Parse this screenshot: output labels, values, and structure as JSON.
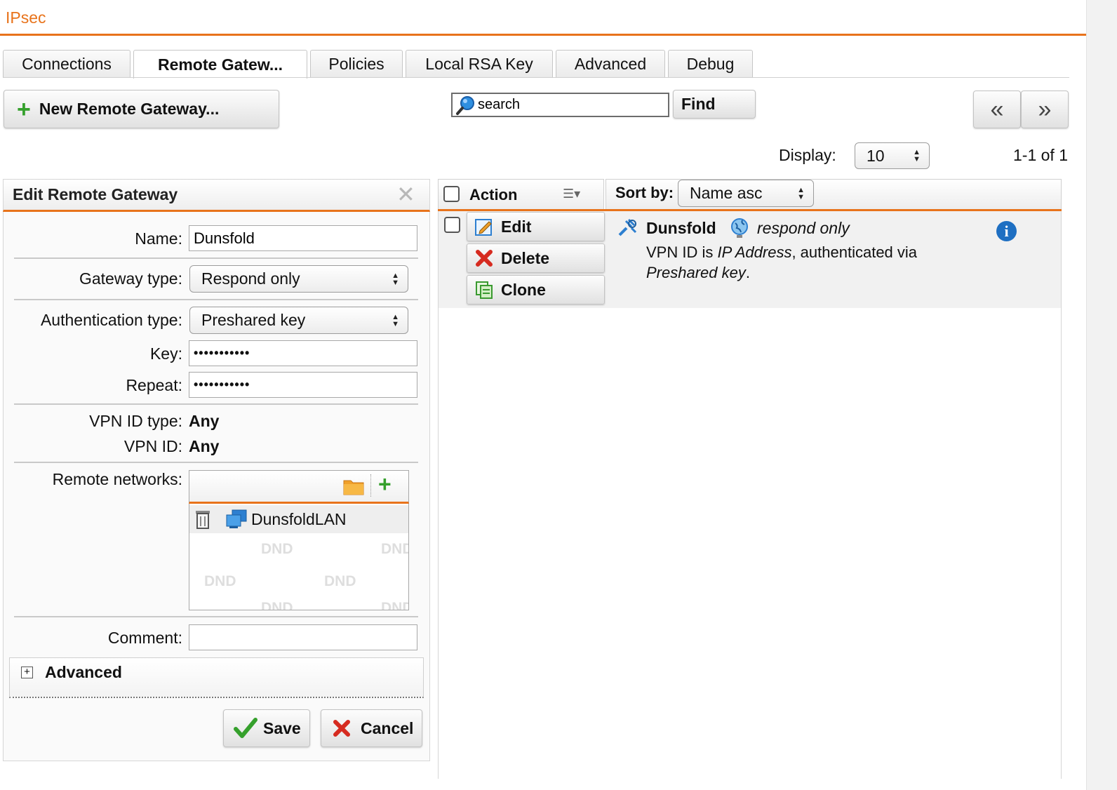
{
  "app": {
    "title": "IPsec"
  },
  "tabs": [
    {
      "label": "Connections"
    },
    {
      "label": "Remote Gatew..."
    },
    {
      "label": "Policies"
    },
    {
      "label": "Local RSA Key"
    },
    {
      "label": "Advanced"
    },
    {
      "label": "Debug"
    }
  ],
  "toolbar": {
    "new_label": "New Remote Gateway...",
    "search_value": "search",
    "find_label": "Find",
    "prev_glyph": "«",
    "next_glyph": "»",
    "display_label": "Display:",
    "display_value": "10",
    "page_count": "1-1 of 1"
  },
  "edit": {
    "title": "Edit Remote Gateway",
    "name_label": "Name:",
    "name_value": "Dunsfold",
    "gateway_type_label": "Gateway type:",
    "gateway_type_value": "Respond only",
    "auth_type_label": "Authentication type:",
    "auth_type_value": "Preshared key",
    "key_label": "Key:",
    "key_value": "•••••••••••",
    "repeat_label": "Repeat:",
    "repeat_value": "•••••••••••",
    "vpn_id_type_label": "VPN ID type:",
    "vpn_id_type_value": "Any",
    "vpn_id_label": "VPN ID:",
    "vpn_id_value": "Any",
    "remote_networks_label": "Remote networks:",
    "network_item": "DunsfoldLAN",
    "dnd_text": "DND",
    "comment_label": "Comment:",
    "comment_value": "",
    "advanced_label": "Advanced",
    "save_label": "Save",
    "cancel_label": "Cancel"
  },
  "list": {
    "action_label": "Action",
    "sort_label": "Sort by:",
    "sort_value": "Name asc",
    "edit_label": "Edit",
    "delete_label": "Delete",
    "clone_label": "Clone",
    "item_name": "Dunsfold",
    "item_mode": "respond only",
    "desc_part1": "VPN ID is ",
    "desc_em1": "IP Address",
    "desc_part2": ", authenticated via",
    "desc_em2": "Preshared key",
    "desc_end": "."
  },
  "colors": {
    "accent": "#e8731b",
    "add_green": "#35a02c",
    "cancel_red": "#d62b20",
    "info_blue": "#1e6fc2"
  }
}
